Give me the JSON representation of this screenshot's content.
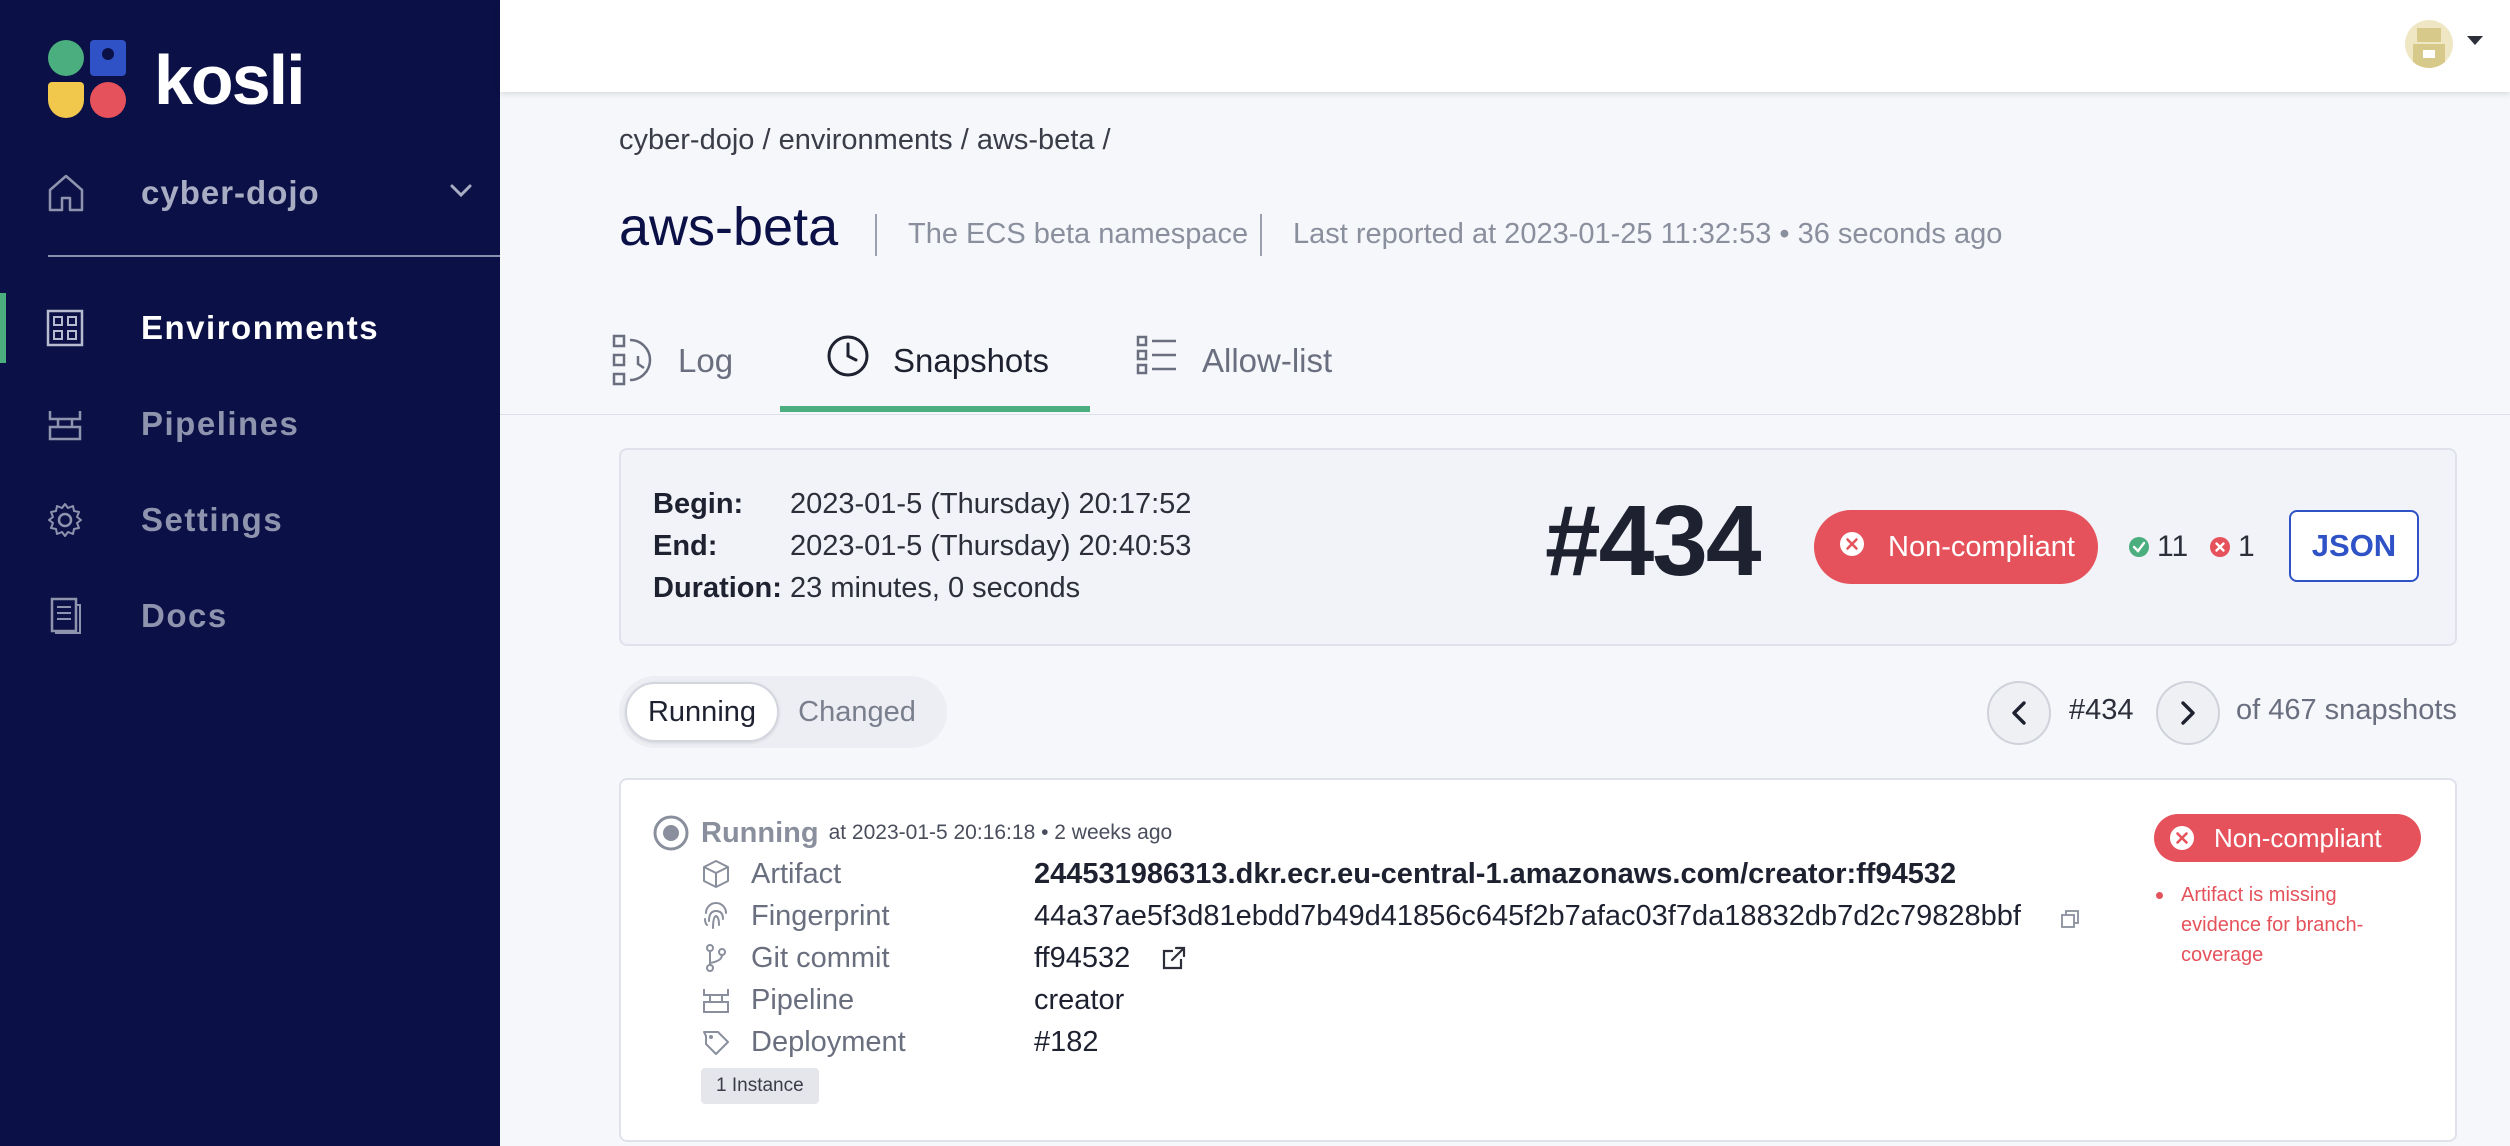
{
  "sidebar": {
    "brand": "kosli",
    "org": "cyber-dojo",
    "items": [
      {
        "label": "Environments",
        "icon": "grid-icon",
        "active": true
      },
      {
        "label": "Pipelines",
        "icon": "pipeline-icon",
        "active": false
      },
      {
        "label": "Settings",
        "icon": "gear-icon",
        "active": false
      },
      {
        "label": "Docs",
        "icon": "document-icon",
        "active": false
      }
    ]
  },
  "header": {
    "breadcrumb": "cyber-dojo / environments / aws-beta /",
    "title": "aws-beta",
    "description": "The ECS beta namespace",
    "last_reported": "Last reported at 2023-01-25 11:32:53 • 36 seconds ago"
  },
  "tabs": [
    {
      "label": "Log",
      "icon": "log-icon",
      "active": false
    },
    {
      "label": "Snapshots",
      "icon": "clock-icon",
      "active": true
    },
    {
      "label": "Allow-list",
      "icon": "list-icon",
      "active": false
    }
  ],
  "snapshot": {
    "begin_label": "Begin:",
    "begin": "2023-01-5 (Thursday) 20:17:52",
    "end_label": "End:",
    "end": "2023-01-5 (Thursday) 20:40:53",
    "duration_label": "Duration:",
    "duration": "23 minutes, 0 seconds",
    "number": "#434",
    "status": "Non-compliant",
    "compliant_count": "11",
    "noncompliant_count": "1",
    "json_label": "JSON"
  },
  "filter": {
    "running_label": "Running",
    "changed_label": "Changed"
  },
  "pagination": {
    "current": "#434",
    "total": "of 467 snapshots"
  },
  "artifact": {
    "state": "Running",
    "state_meta": "at 2023-01-5 20:16:18 • 2 weeks ago",
    "fields": [
      {
        "key": "Artifact",
        "value": "244531986313.dkr.ecr.eu-central-1.amazonaws.com/creator:ff94532",
        "icon": "cube-icon"
      },
      {
        "key": "Fingerprint",
        "value": "44a37ae5f3d81ebdd7b49d41856c645f2b7afac03f7da18832db7d2c79828bbf",
        "icon": "fingerprint-icon"
      },
      {
        "key": "Git commit",
        "value": "ff94532",
        "icon": "git-branch-icon"
      },
      {
        "key": "Pipeline",
        "value": "creator",
        "icon": "pipeline-icon"
      },
      {
        "key": "Deployment",
        "value": "#182",
        "icon": "deployment-icon"
      }
    ],
    "instances": "1 Instance",
    "status": "Non-compliant",
    "issue": "Artifact is missing evidence for branch-coverage"
  },
  "colors": {
    "sidebar_bg": "#0b1146",
    "accent_green": "#4bae7f",
    "danger": "#e5525b",
    "link_blue": "#2f52c6"
  }
}
